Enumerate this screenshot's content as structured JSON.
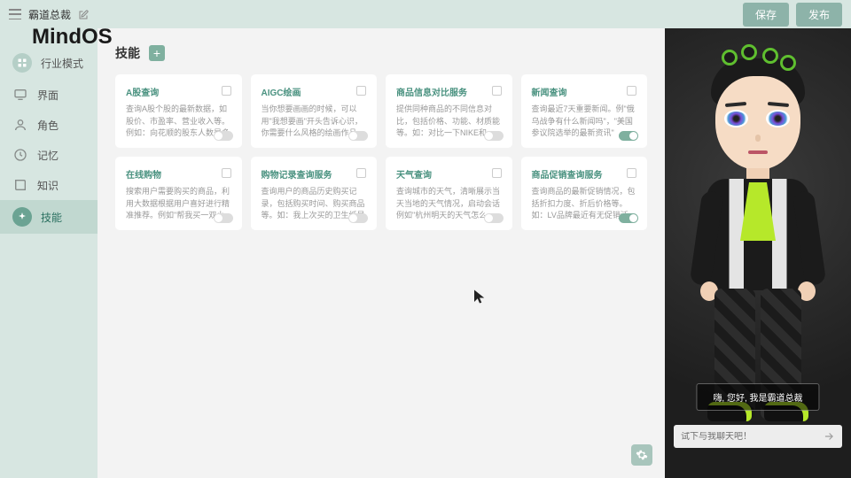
{
  "topbar": {
    "title": "霸道总裁",
    "save_label": "保存",
    "publish_label": "发布"
  },
  "logo": "MindOS",
  "sidebar": {
    "items": [
      {
        "label": "行业模式"
      },
      {
        "label": "界面"
      },
      {
        "label": "角色"
      },
      {
        "label": "记忆"
      },
      {
        "label": "知识"
      },
      {
        "label": "技能"
      }
    ]
  },
  "content": {
    "title": "技能"
  },
  "cards": [
    {
      "title": "A股查询",
      "desc": "查询A股个股的最新数据，如股价、市盈率、营业收入等。例如：向花顺的股东人数是多少",
      "on": false
    },
    {
      "title": "AIGC绘画",
      "desc": "当你想要画画的时候，可以用\"我想要画\"开头告诉心识，你需要什么风格的绘画作品",
      "on": false
    },
    {
      "title": "商品信息对比服务",
      "desc": "提供同种商品的不同信息对比，包括价格、功能、材质能等。如：对比一下NIKE和ADIDAS家的毛衣差异。",
      "on": false
    },
    {
      "title": "新闻查询",
      "desc": "查询最近7天重要新闻。例\"俄乌战争有什么新闻吗\"，\"美国参议院选举的最新资讯\"",
      "on": true
    },
    {
      "title": "在线购物",
      "desc": "搜索用户需要购买的商品，利用大数据根据用户喜好进行精准推荐。例如\"帮我买一双小白鞋\"",
      "on": false
    },
    {
      "title": "购物记录查询服务",
      "desc": "查询用户的商品历史购买记录，包括购买时间、购买商品等。如：我上次买的卫生纸是多少钱？",
      "on": false
    },
    {
      "title": "天气查询",
      "desc": "查询城市的天气，清晰展示当天当地的天气情况，启动会话例如\"杭州明天的天气怎么样\"。",
      "on": false
    },
    {
      "title": "商品促销查询服务",
      "desc": "查询商品的最新促销情况，包括折扣力度、折后价格等。如：LV品牌最近有无促销活动？",
      "on": true
    }
  ],
  "preview": {
    "greeting": "嗨, 您好, 我是霸道总裁",
    "chat_placeholder": "试下与我聊天吧！"
  }
}
